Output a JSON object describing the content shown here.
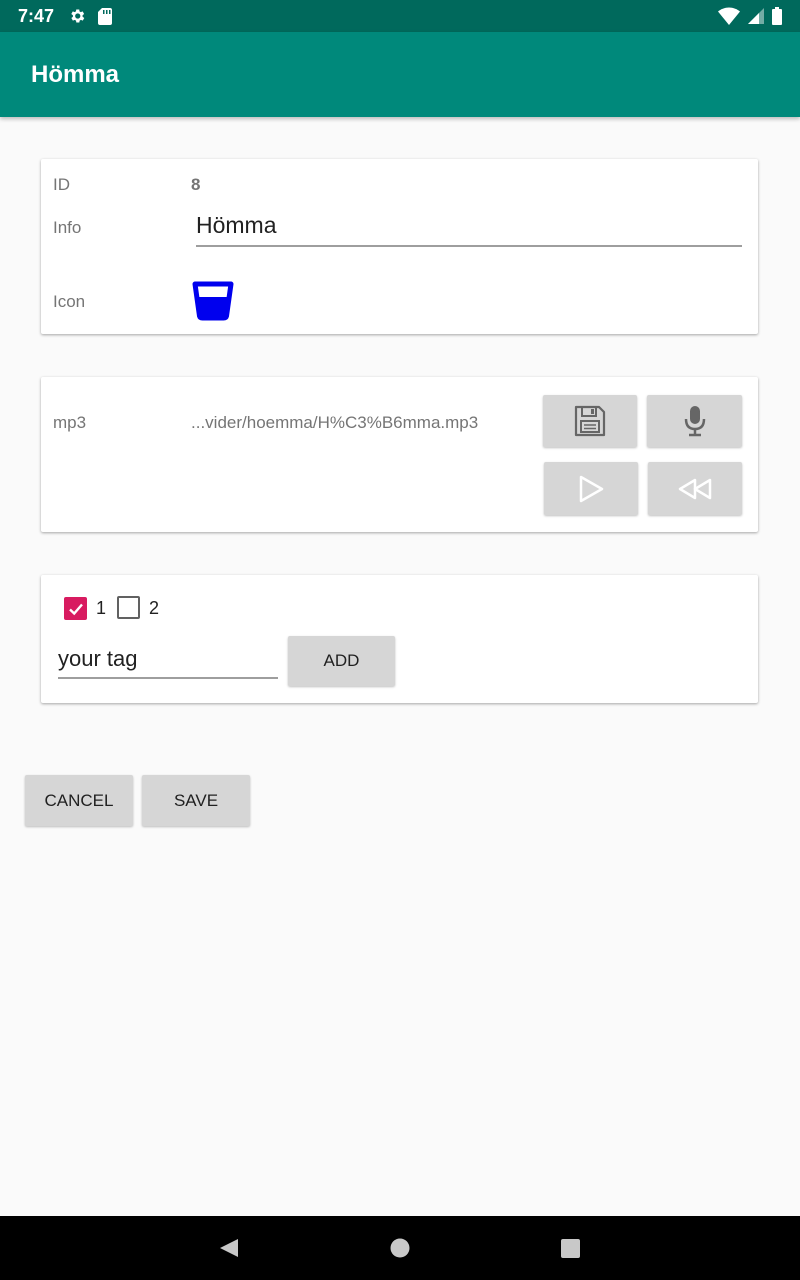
{
  "status_bar": {
    "time": "7:47",
    "icons": [
      "gear-icon",
      "sd-card-icon",
      "wifi-icon",
      "signal-icon",
      "battery-icon"
    ]
  },
  "app_bar": {
    "title": "Hömma"
  },
  "details": {
    "id_label": "ID",
    "id_value": "8",
    "info_label": "Info",
    "info_value": "Hömma",
    "icon_label": "Icon",
    "icon_name": "glass-icon",
    "icon_color": "#0000ee"
  },
  "audio": {
    "label": "mp3",
    "path": "...vider/hoemma/H%C3%B6mma.mp3",
    "buttons": [
      "save-file-icon",
      "microphone-icon",
      "play-icon",
      "rewind-icon"
    ]
  },
  "tags": {
    "items": [
      {
        "label": "1",
        "checked": true
      },
      {
        "label": "2",
        "checked": false
      }
    ],
    "input_placeholder": "your tag",
    "add_label": "ADD"
  },
  "actions": {
    "cancel_label": "CANCEL",
    "save_label": "SAVE"
  },
  "colors": {
    "status_bar": "#00695c",
    "app_bar": "#00897b",
    "checkbox_accent": "#d81b60"
  }
}
